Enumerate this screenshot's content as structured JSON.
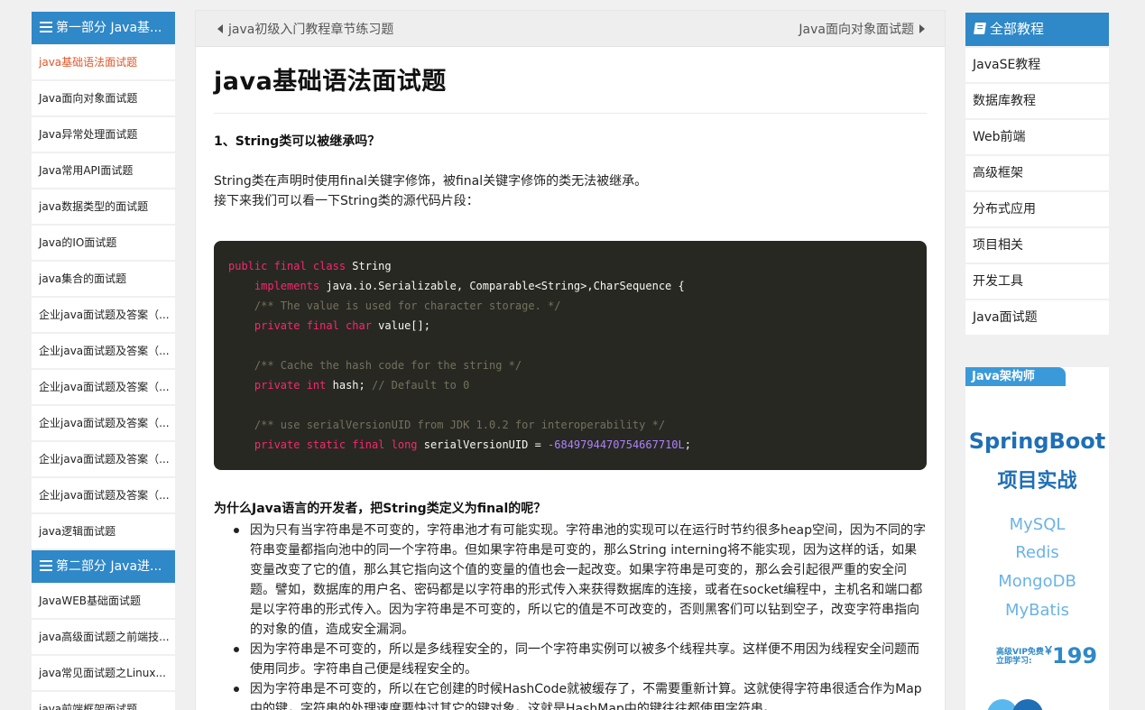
{
  "left_sidebar": {
    "sections": [
      {
        "title": "第一部分 Java基...",
        "items": [
          "java基础语法面试题",
          "Java面向对象面试题",
          "Java异常处理面试题",
          "Java常用API面试题",
          "java数据类型的面试题",
          "Java的IO面试题",
          "java集合的面试题",
          "企业java面试题及答案（...",
          "企业java面试题及答案（...",
          "企业java面试题及答案（...",
          "企业java面试题及答案（...",
          "企业java面试题及答案（...",
          "企业java面试题及答案（...",
          "java逻辑面试题"
        ]
      },
      {
        "title": "第二部分 Java进...",
        "items": [
          "JavaWEB基础面试题",
          "java高级面试题之前端技...",
          "java常见面试题之Linux...",
          "java前端框架面试题"
        ]
      }
    ],
    "active_item": "java基础语法面试题"
  },
  "nav": {
    "prev": "java初级入门教程章节练习题",
    "next": "Java面向对象面试题"
  },
  "article": {
    "title": "java基础语法面试题",
    "q1": "1、String类可以被继承吗？",
    "p1_line1": "String类在声明时使用final关键字修饰，被final关键字修饰的类无法被继承。",
    "p1_line2": "接下来我们可以看一下String类的源代码片段：",
    "code": {
      "l1_k": "public final class",
      "l1_t": " String",
      "l2_k": "implements",
      "l2_t": " java.io.Serializable, Comparable<String>,CharSequence {",
      "l3_c": "/** The value is used for character storage. */",
      "l4_k": "private final char",
      "l4_t": " value[];",
      "l6_c": "/** Cache the hash code for the string */",
      "l7_k": "private int",
      "l7_t": " hash; ",
      "l7_c": "// Default to 0",
      "l9_c": "/** use serialVersionUID from JDK 1.0.2 for interoperability */",
      "l10_k": "private static final long",
      "l10_t": " serialVersionUID = ",
      "l10_n": "-6849794470754667710L",
      "l10_e": ";"
    },
    "q2": "为什么Java语言的开发者，把String类定义为final的呢？",
    "bullets": [
      "因为只有当字符串是不可变的，字符串池才有可能实现。字符串池的实现可以在运行时节约很多heap空间，因为不同的字符串变量都指向池中的同一个字符串。但如果字符串是可变的，那么String interning将不能实现，因为这样的话，如果变量改变了它的值，那么其它指向这个值的变量的值也会一起改变。如果字符串是可变的，那么会引起很严重的安全问题。譬如，数据库的用户名、密码都是以字符串的形式传入来获得数据库的连接，或者在socket编程中，主机名和端口都是以字符串的形式传入。因为字符串是不可变的，所以它的值是不可改变的，否则黑客们可以钻到空子，改变字符串指向的对象的值，造成安全漏洞。",
      "因为字符串是不可变的，所以是多线程安全的，同一个字符串实例可以被多个线程共享。这样便不用因为线程安全问题而使用同步。字符串自己便是线程安全的。",
      "因为字符串是不可变的，所以在它创建的时候HashCode就被缓存了，不需要重新计算。这就使得字符串很适合作为Map中的键，字符串的处理速度要快过其它的键对象。这就是HashMap中的键往往都使用字符串。"
    ]
  },
  "right_sidebar": {
    "title": "全部教程",
    "items": [
      "JavaSE教程",
      "数据库教程",
      "Web前端",
      "高级框架",
      "分布式应用",
      "项目相关",
      "开发工具",
      "Java面试题"
    ]
  },
  "ad": {
    "tag": "Java架构师",
    "line1": "SpringBoot",
    "line2": "项目实战",
    "tech": [
      "MySQL",
      "Redis",
      "MongoDB",
      "MyBatis"
    ],
    "vip1": "高级VIP免费",
    "vip2": "立即学习:",
    "currency": "￥",
    "price": "199"
  },
  "colors": {
    "accent": "#2f88c8",
    "active_link": "#e2562a",
    "code_bg": "#272822"
  }
}
